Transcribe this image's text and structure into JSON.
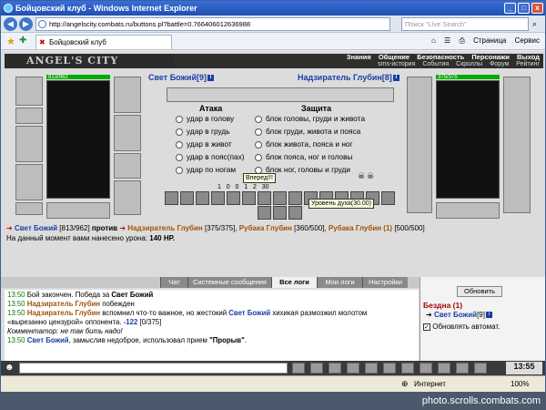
{
  "window": {
    "title": "Бойцовский клуб - Windows Internet Explorer",
    "min": "_",
    "max": "□",
    "close": "x"
  },
  "address": {
    "url": "http://angelscity.combats.ru/buttons.pl?battle=0.766406012636988",
    "search_placeholder": "Поиск \"Live Search\""
  },
  "tab": {
    "label": "Бойцовский клуб"
  },
  "toolbar": {
    "page": "Страница",
    "service": "Сервис"
  },
  "game": {
    "logo": "ANGEL'S CITY",
    "menu_top": [
      "Знания",
      "Общение",
      "Безопасность",
      "Персонажи",
      "Выход"
    ],
    "menu_bottom": [
      "sms-история",
      "События",
      "Скроллы",
      "Форум",
      "Рейтинг"
    ],
    "hp_left": "813/962",
    "hp_right": "375/375",
    "player": {
      "name": "Свет Божий",
      "level": "[9]",
      "hp": "[813/962]"
    },
    "enemy": {
      "name": "Надзиратель Глубин",
      "level": "[8]",
      "hp": "[375/375]"
    },
    "attack_title": "Атака",
    "defense_title": "Защита",
    "attacks": [
      "удар в голову",
      "удар в грудь",
      "удар в живот",
      "удар в пояс(пах)",
      "удар по ногам"
    ],
    "defenses": [
      "блок головы, груди и живота",
      "блок груди, живота и пояса",
      "блок живота, пояса и ног",
      "блок пояса, ног и головы",
      "блок ног, головы и груди"
    ],
    "counters": [
      "1",
      "0",
      "0",
      "1",
      "2",
      "30"
    ],
    "forward_button": "Вперед!!!",
    "tooltip": "Уровень духа(30.00)",
    "vs_word": "против",
    "enemy2": {
      "name": "Рубака Глубин",
      "hp": "[360/500]"
    },
    "enemy3": {
      "name": "Рубака Глубин (1)",
      "hp": "[500/500]"
    },
    "damage_prefix": "На данный момент вами нанесено урона:",
    "damage_value": "140 HP."
  },
  "chat": {
    "tabs": [
      "Чат",
      "Системные сообщения",
      "Все логи",
      "Мои логи",
      "Настройки"
    ],
    "active": "Все логи",
    "lines": [
      {
        "time": "13:50",
        "text": "Бой закончен. Победа за ",
        "name": "Свет Божий"
      },
      {
        "time": "13:50",
        "name": "Надзиратель Глубин",
        "text": " побежден"
      },
      {
        "time": "13:50",
        "name": "Надзиратель Глубин",
        "text": " вспомнил что-то важное, но жестокий ",
        "name2": "Свет Божий",
        "text2": " хихикая размозжил молотом"
      },
      {
        "text": "«вырезанно цензурой» оппонента. ",
        "dmg": "-122",
        "hp": " [0/375]"
      },
      {
        "comment": "Комментатор: не так бить надо!"
      },
      {
        "time": "13:50",
        "name": "Свет Божий",
        "text": ", замыслив недоброе, использовал прием ",
        "special": "\"Прорыв\"",
        "end": "."
      }
    ]
  },
  "side": {
    "refresh": "Обновить",
    "location": "Бездна (1)",
    "user": "Свет Божий",
    "level": "[9]",
    "auto": "Обновлять автомат."
  },
  "clock": "13:55",
  "status": {
    "zone": "Интернет",
    "zoom": "100%"
  },
  "watermark": "photo.scrolls.combats.com"
}
